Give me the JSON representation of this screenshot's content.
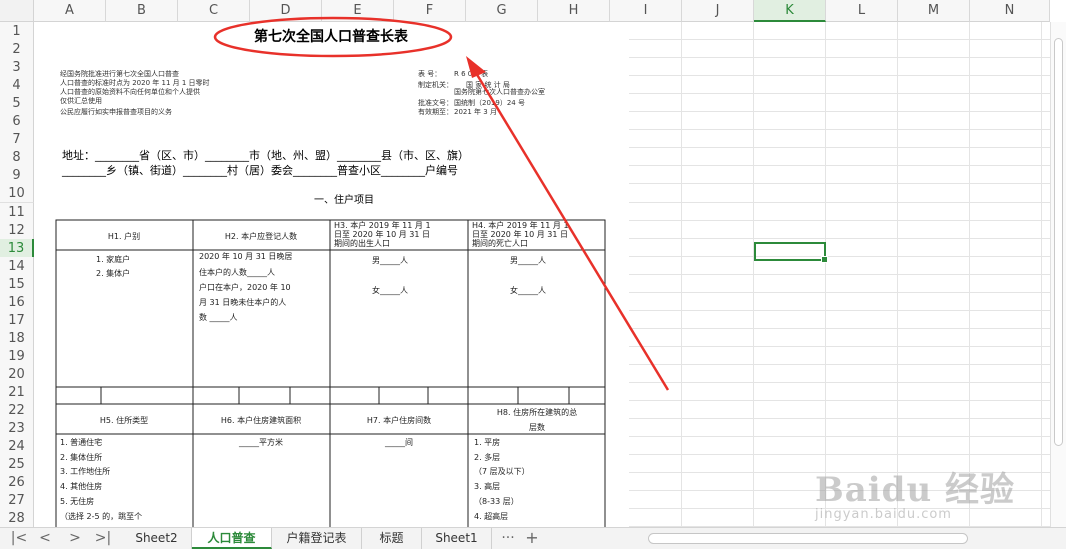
{
  "columns": [
    "A",
    "B",
    "C",
    "D",
    "E",
    "F",
    "G",
    "H",
    "I",
    "J",
    "K",
    "L",
    "M",
    "N"
  ],
  "selected_column": "K",
  "rows": [
    "1",
    "2",
    "3",
    "4",
    "5",
    "6",
    "7",
    "8",
    "9",
    "10",
    "11",
    "12",
    "13",
    "14",
    "15",
    "16",
    "17",
    "18",
    "19",
    "20",
    "21",
    "22",
    "23",
    "24",
    "25",
    "26",
    "27",
    "28"
  ],
  "selected_row": "13",
  "form": {
    "title": "第七次全国人口普查长表",
    "notice_lines": [
      "经国务院批准进行第七次全国人口普查",
      "人口普查的标准时点为 2020 年 11 月 1 日零时",
      "人口普查的原始资料不向任何单位和个人提供",
      "仅供汇总使用",
      "公民应履行如实申报普查项目的义务"
    ],
    "meta": [
      {
        "label": "表 号：",
        "value": "R 6 0 2 表"
      },
      {
        "label": "制定机关：",
        "value": "国 家 统 计 局"
      },
      {
        "label": "",
        "value": "国务院第七次人口普查办公室"
      },
      {
        "label": "批准文号：",
        "value": "国统制（2019）24 号"
      },
      {
        "label": "有效期至：",
        "value": "2021 年 3 月"
      }
    ],
    "address_line1": "地址：________省（区、市）________市（地、州、盟）________县（市、区、旗）",
    "address_line2": "________乡（镇、街道）________村（居）委会________普查小区________户编号",
    "section_title": "一、住户项目",
    "h1": {
      "header": "H1. 户别",
      "options": [
        "1. 家庭户",
        "2. 集体户"
      ]
    },
    "h2": {
      "header": "H2. 本户应登记人数",
      "text": [
        "2020 年 10 月 31 日晚居",
        "住本户的人数_____人",
        "户口在本户，2020 年 10",
        "月 31 日晚未住本户的人",
        "数 _____人"
      ]
    },
    "h3": {
      "header": [
        "H3. 本户 2019 年 11 月 1",
        "日至 2020 年 10 月 31 日",
        "期间的出生人口"
      ],
      "male": "男_____人",
      "female": "女_____人"
    },
    "h4": {
      "header": [
        "H4. 本户 2019 年 11 月 1",
        "日至 2020 年 10 月 31 日",
        "期间的死亡人口"
      ],
      "male": "男_____人",
      "female": "女_____人"
    },
    "h5": {
      "header": "H5. 住所类型",
      "options": [
        "1. 普通住宅",
        "2. 集体住所",
        "3. 工作地住所",
        "4. 其他住房",
        "5. 无住房",
        "（选择 2-5 的，跳至个"
      ]
    },
    "h6": {
      "header": "H6. 本户住房建筑面积",
      "text": "_____平方米"
    },
    "h7": {
      "header": "H7. 本户住房间数",
      "text": "_____间"
    },
    "h8": {
      "header": [
        "H8. 住房所在建筑的总",
        "层数"
      ],
      "options": [
        "1. 平房",
        "2. 多层",
        "（7 层及以下）",
        "3. 高层",
        "（8-33 层）",
        "4. 超高层"
      ]
    }
  },
  "sheet_tabs": [
    "Sheet2",
    "人口普查",
    "户籍登记表",
    "标题",
    "Sheet1"
  ],
  "active_tab": "人口普查",
  "more_label": "···",
  "add_label": "+",
  "watermark": {
    "main": "Baidu 经验",
    "sub": "jingyan.baidu.com"
  },
  "colors": {
    "accent": "#2c8a3a",
    "annotation": "#e8312a"
  }
}
